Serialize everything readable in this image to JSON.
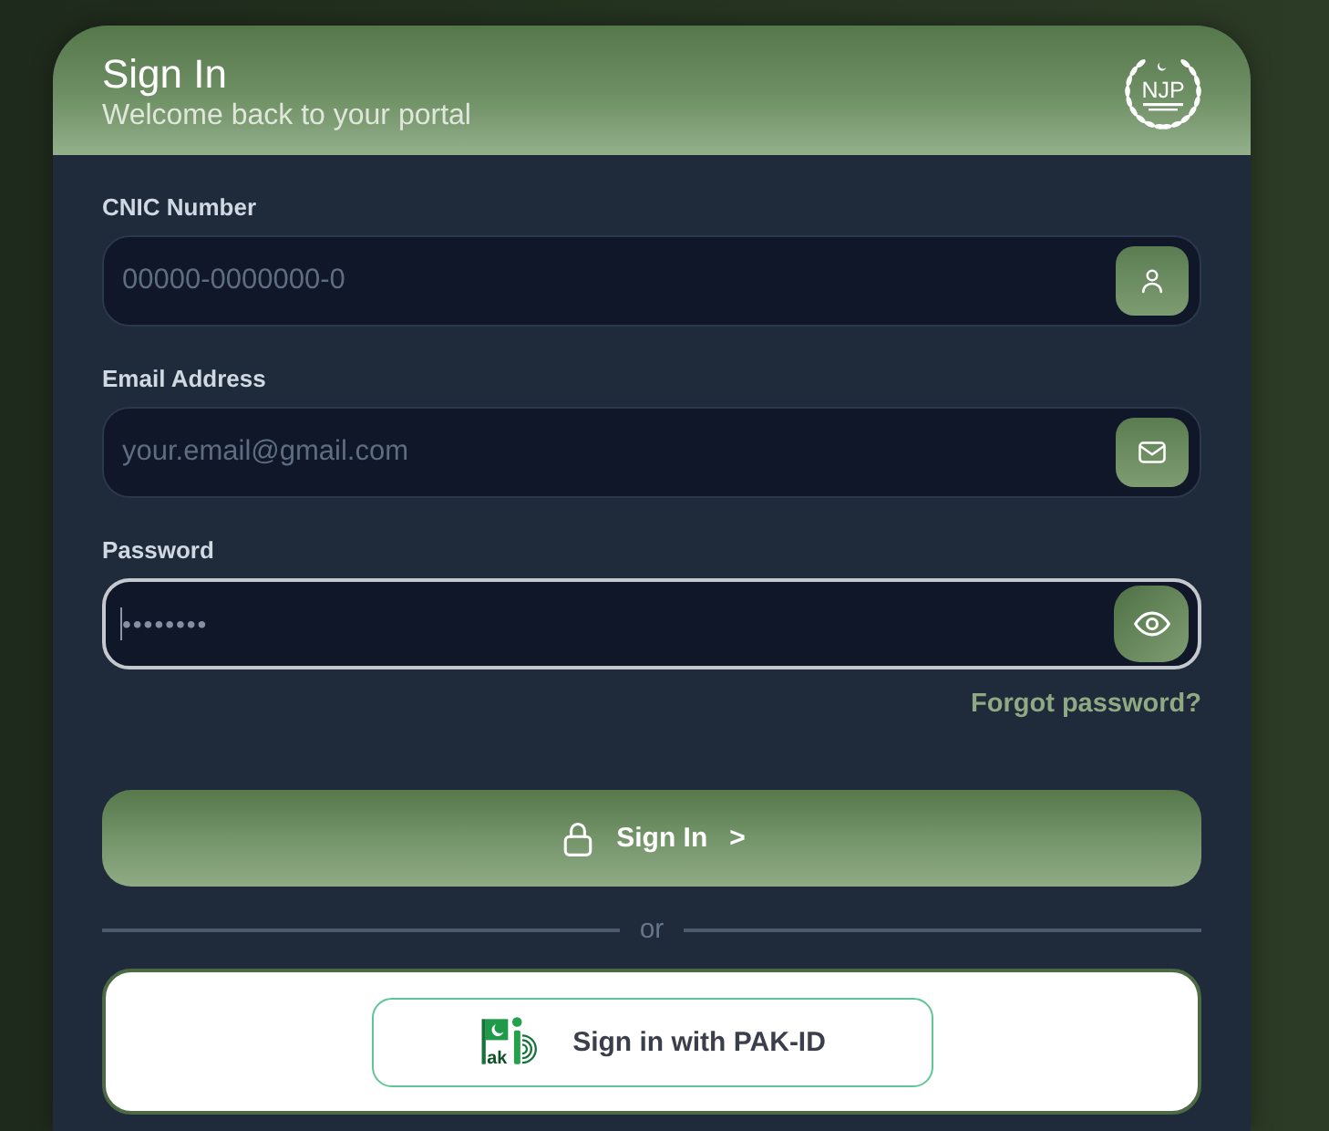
{
  "header": {
    "title": "Sign In",
    "subtitle": "Welcome back to your portal",
    "emblem_text": "NJP"
  },
  "fields": [
    {
      "kind": "identity",
      "label": "CNIC Number",
      "placeholder": "00000-0000000-0",
      "focused": false
    },
    {
      "kind": "email",
      "label": "Email Address",
      "placeholder": "your.email@gmail.com",
      "focused": false
    },
    {
      "kind": "password",
      "label": "Password",
      "value": "••••••••",
      "focused": true
    }
  ],
  "forgot_link": "Forgot password?",
  "submit": {
    "label": "Sign In",
    "chevron": ">"
  },
  "divider": "or",
  "pak_id": {
    "label": "Sign in with PAK-ID",
    "logo_text": "ak"
  }
}
